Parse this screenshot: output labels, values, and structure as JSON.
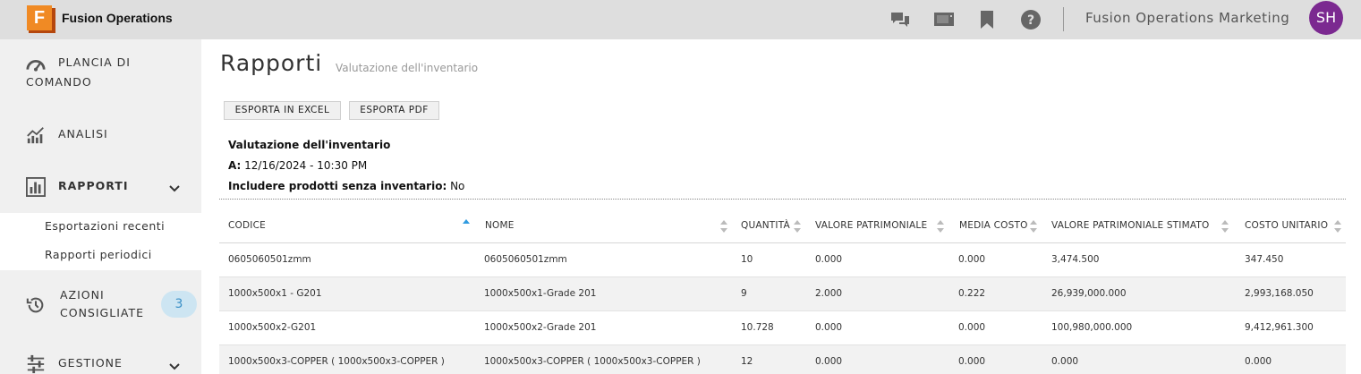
{
  "header": {
    "app_title": "Fusion Operations",
    "logo_letter": "F",
    "org_name": "Fusion Operations Marketing",
    "avatar_initials": "SH",
    "icons": [
      "chat-icon",
      "display-icon",
      "bookmark-icon",
      "help-icon"
    ]
  },
  "sidebar": {
    "items": [
      {
        "label_line1": "PLANCIA DI",
        "label_line2": "COMANDO",
        "icon": "speedometer-icon"
      },
      {
        "label": "ANALISI",
        "icon": "line-chart-icon"
      },
      {
        "label": "RAPPORTI",
        "icon": "report-icon",
        "expanded": true
      },
      {
        "label_line1": "AZIONI",
        "label_line2": "CONSIGLIATE",
        "icon": "history-icon",
        "badge": "3"
      },
      {
        "label": "GESTIONE",
        "icon": "sliders-icon"
      }
    ],
    "sub_items": [
      "Esportazioni recenti",
      "Rapporti periodici"
    ]
  },
  "page": {
    "title": "Rapporti",
    "subtitle": "Valutazione dell'inventario",
    "buttons": {
      "excel": "ESPORTA IN EXCEL",
      "pdf": "ESPORTA PDF"
    },
    "report_name": "Valutazione dell'inventario",
    "date_label": "A:",
    "date_value": "12/16/2024 - 10:30 PM",
    "include_label": "Includere prodotti senza inventario:",
    "include_value": "No"
  },
  "table": {
    "columns": [
      "CODICE",
      "NOME",
      "QUANTITÀ",
      "VALORE PATRIMONIALE",
      "MEDIA COSTO",
      "VALORE PATRIMONIALE STIMATO",
      "COSTO UNITARIO"
    ],
    "sorted_column": "CODICE",
    "sort_direction": "ascending",
    "rows": [
      [
        "0605060501zmm",
        "0605060501zmm",
        "10",
        "0.000",
        "0.000",
        "3,474.500",
        "347.450"
      ],
      [
        "1000x500x1 - G201",
        "1000x500x1-Grade 201",
        "9",
        "2.000",
        "0.222",
        "26,939,000.000",
        "2,993,168.050"
      ],
      [
        "1000x500x2-G201",
        "1000x500x2-Grade 201",
        "10.728",
        "0.000",
        "0.000",
        "100,980,000.000",
        "9,412,961.300"
      ],
      [
        "1000x500x3-COPPER ( 1000x500x3-COPPER )",
        "1000x500x3-COPPER ( 1000x500x3-COPPER )",
        "12",
        "0.000",
        "0.000",
        "0.000",
        "0.000"
      ]
    ]
  },
  "colors": {
    "topbar": "#dedede",
    "sidebar": "#f0f0f0",
    "avatar": "#7b2990",
    "logo": "#f08a24",
    "badge_bg": "#cde5f2",
    "badge_text": "#3a8fc6",
    "sort_active": "#2f9be0"
  }
}
